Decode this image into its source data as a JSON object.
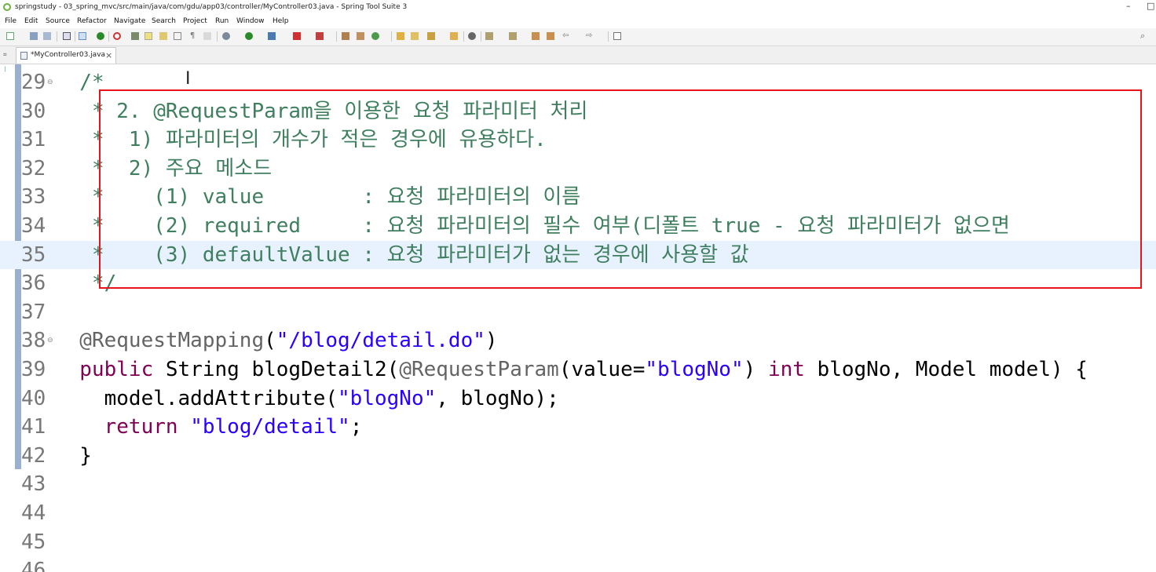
{
  "window": {
    "title": "springstudy - 03_spring_mvc/src/main/java/com/gdu/app03/controller/MyController03.java - Spring Tool Suite 3",
    "minimize": "–",
    "maximize": "□"
  },
  "menu": [
    "File",
    "Edit",
    "Source",
    "Refactor",
    "Navigate",
    "Search",
    "Project",
    "Run",
    "Window",
    "Help"
  ],
  "editor_tab": {
    "label": "*MyController03.java",
    "close": "×"
  },
  "colors": {
    "highlight_box": "#e8141a",
    "comment": "#3f7f5f",
    "keyword": "#7f0055",
    "string": "#2a00ff",
    "annotation": "#646464",
    "current_line": "#e8f2fe"
  },
  "code": {
    "current_line": 35,
    "lines": [
      {
        "num": "29",
        "fold": "⊖",
        "tokens": [
          [
            "cm",
            "  /*"
          ]
        ]
      },
      {
        "num": "30",
        "tokens": [
          [
            "cm",
            "   * 2. @RequestParam을 이용한 요청 파라미터 처리"
          ]
        ]
      },
      {
        "num": "31",
        "tokens": [
          [
            "cm",
            "   *  1) 파라미터의 개수가 적은 경우에 유용하다."
          ]
        ]
      },
      {
        "num": "32",
        "tokens": [
          [
            "cm",
            "   *  2) 주요 메소드"
          ]
        ]
      },
      {
        "num": "33",
        "tokens": [
          [
            "cm",
            "   *    (1) value        : 요청 파라미터의 이름"
          ]
        ]
      },
      {
        "num": "34",
        "tokens": [
          [
            "cm",
            "   *    (2) required     : 요청 파라미터의 필수 여부(디폴트 true - 요청 파라미터가 없으면"
          ]
        ]
      },
      {
        "num": "35",
        "tokens": [
          [
            "cm",
            "   *    (3) defaultValue : 요청 파라미터가 없는 경우에 사용할 값"
          ]
        ]
      },
      {
        "num": "36",
        "tokens": [
          [
            "cm",
            "   */"
          ]
        ]
      },
      {
        "num": "37",
        "tokens": []
      },
      {
        "num": "38",
        "fold": "⊖",
        "tokens": [
          [
            "ann",
            "  @RequestMapping"
          ],
          [
            "plain",
            "("
          ],
          [
            "str",
            "\"/blog/detail.do\""
          ],
          [
            "plain",
            ")"
          ]
        ]
      },
      {
        "num": "39",
        "tokens": [
          [
            "kw",
            "  public"
          ],
          [
            "plain",
            " String blogDetail2("
          ],
          [
            "ann",
            "@RequestParam"
          ],
          [
            "plain",
            "(value="
          ],
          [
            "str",
            "\"blogNo\""
          ],
          [
            "plain",
            ") "
          ],
          [
            "kw",
            "int"
          ],
          [
            "plain",
            " blogNo, Model model) {"
          ]
        ]
      },
      {
        "num": "40",
        "tokens": [
          [
            "plain",
            "    model.addAttribute("
          ],
          [
            "str",
            "\"blogNo\""
          ],
          [
            "plain",
            ", blogNo);"
          ]
        ]
      },
      {
        "num": "41",
        "tokens": [
          [
            "kw",
            "    return"
          ],
          [
            "plain",
            " "
          ],
          [
            "str",
            "\"blog/detail\""
          ],
          [
            "plain",
            ";"
          ]
        ]
      },
      {
        "num": "42",
        "tokens": [
          [
            "plain",
            "  }"
          ]
        ]
      },
      {
        "num": "43",
        "tokens": []
      },
      {
        "num": "44",
        "tokens": []
      },
      {
        "num": "45",
        "tokens": []
      },
      {
        "num": "46",
        "tokens": []
      }
    ]
  }
}
